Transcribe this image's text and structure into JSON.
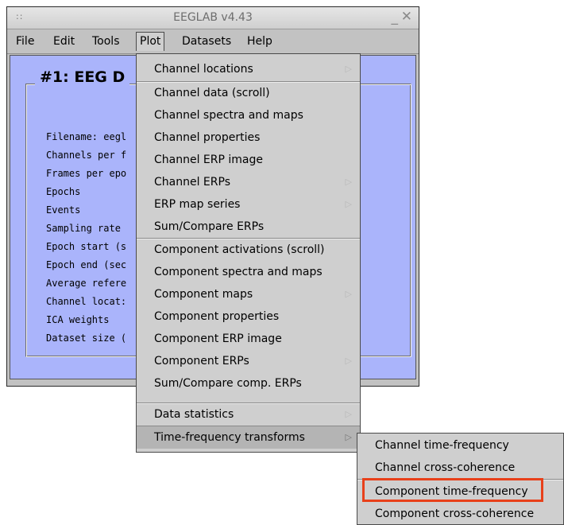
{
  "window": {
    "title": "EEGLAB v4.43",
    "grip": "::",
    "minimize": "_",
    "close": "✕"
  },
  "menubar": {
    "items": [
      "File",
      "Edit",
      "Tools",
      "Plot",
      "Datasets",
      "Help"
    ],
    "active": "Plot"
  },
  "dataset": {
    "title": "#1: EEG D",
    "rows": [
      "Filename: eegl",
      "Channels per f",
      "Frames per epo",
      "Epochs",
      "Events",
      "Sampling rate",
      "Epoch start (s",
      "Epoch end (sec",
      "Average refere",
      "Channel locat:",
      "ICA weights",
      "Dataset size ("
    ]
  },
  "plot_menu": {
    "items": [
      {
        "label": "Channel locations",
        "submenu": true
      },
      {
        "label": "Channel data (scroll)",
        "submenu": false
      },
      {
        "label": "Channel spectra and maps",
        "submenu": false
      },
      {
        "label": "Channel properties",
        "submenu": false
      },
      {
        "label": "Channel ERP image",
        "submenu": false
      },
      {
        "label": "Channel ERPs",
        "submenu": true
      },
      {
        "label": "ERP map series",
        "submenu": true
      },
      {
        "label": "Sum/Compare ERPs",
        "submenu": false
      },
      {
        "label": "Component activations (scroll)",
        "submenu": false
      },
      {
        "label": "Component spectra and maps",
        "submenu": false
      },
      {
        "label": "Component maps",
        "submenu": true
      },
      {
        "label": "Component properties",
        "submenu": false
      },
      {
        "label": "Component ERP image",
        "submenu": false
      },
      {
        "label": "Component ERPs",
        "submenu": true
      },
      {
        "label": "Sum/Compare comp. ERPs",
        "submenu": false
      },
      {
        "label": "Data statistics",
        "submenu": true
      },
      {
        "label": "Time-frequency transforms",
        "submenu": true,
        "open": true
      }
    ],
    "arrow_glyph": "▷"
  },
  "tf_submenu": {
    "items": [
      "Channel time-frequency",
      "Channel cross-coherence",
      "Component time-frequency",
      "Component cross-coherence"
    ],
    "highlighted": "Component time-frequency",
    "highlight_color": "#e8401a"
  },
  "colors": {
    "content_bg": "#aab4fb",
    "menu_bg": "#cfcfcf",
    "window_bg": "#c2c2c2"
  }
}
